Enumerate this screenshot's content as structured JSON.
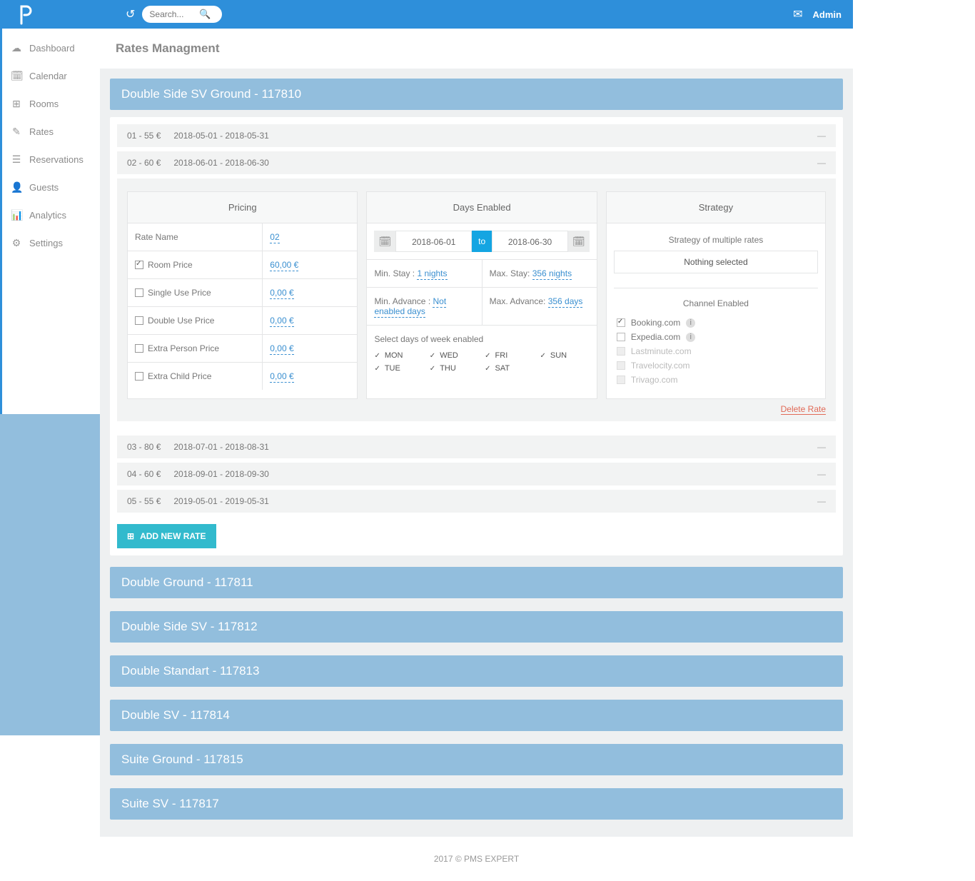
{
  "header": {
    "search_placeholder": "Search...",
    "user": "Admin"
  },
  "sidebar": {
    "items": [
      {
        "label": "Dashboard",
        "icon": "☁"
      },
      {
        "label": "Calendar",
        "icon": "🗓"
      },
      {
        "label": "Rooms",
        "icon": "⊞"
      },
      {
        "label": "Rates",
        "icon": "✎"
      },
      {
        "label": "Reservations",
        "icon": "☰"
      },
      {
        "label": "Guests",
        "icon": "👤"
      },
      {
        "label": "Analytics",
        "icon": "📊"
      },
      {
        "label": "Settings",
        "icon": "⚙"
      }
    ]
  },
  "page": {
    "title": "Rates Managment"
  },
  "room_types": [
    {
      "label": "Double Side SV Ground - 117810",
      "expanded": true
    },
    {
      "label": "Double Ground - 117811"
    },
    {
      "label": "Double Side SV - 117812"
    },
    {
      "label": "Double Standart - 117813"
    },
    {
      "label": "Double SV - 117814"
    },
    {
      "label": "Suite Ground - 117815"
    },
    {
      "label": "Suite SV - 117817"
    }
  ],
  "rates": [
    {
      "id": "01 - 55 €",
      "range": "2018-05-01 - 2018-05-31"
    },
    {
      "id": "02 - 60 €",
      "range": "2018-06-01 - 2018-06-30"
    },
    {
      "id": "03 - 80 €",
      "range": "2018-07-01 - 2018-08-31"
    },
    {
      "id": "04 - 60 €",
      "range": "2018-09-01 - 2018-09-30"
    },
    {
      "id": "05 - 55 €",
      "range": "2019-05-01 - 2019-05-31"
    }
  ],
  "pricing": {
    "header": "Pricing",
    "rows": [
      {
        "label": "Rate Name",
        "value": "02",
        "has_cb": false
      },
      {
        "label": "Room Price",
        "value": "60,00 €",
        "checked": true
      },
      {
        "label": "Single Use Price",
        "value": "0,00 €",
        "checked": false
      },
      {
        "label": "Double Use Price",
        "value": "0,00 €",
        "checked": false
      },
      {
        "label": "Extra Person Price",
        "value": "0,00 €",
        "checked": false
      },
      {
        "label": "Extra Child Price",
        "value": "0,00 €",
        "checked": false
      }
    ]
  },
  "days": {
    "header": "Days Enabled",
    "from": "2018-06-01",
    "to_label": "to",
    "to": "2018-06-30",
    "min_stay_label": "Min. Stay : ",
    "min_stay_val": "1 nights",
    "max_stay_label": "Max. Stay: ",
    "max_stay_val": "356 nights",
    "min_adv_label": "Min. Advance : ",
    "min_adv_val": "Not enabled days",
    "max_adv_label": "Max. Advance: ",
    "max_adv_val": "356 days",
    "week_label": "Select days of week enabled",
    "weekdays": [
      "MON",
      "WED",
      "FRI",
      "SUN",
      "TUE",
      "THU",
      "SAT"
    ]
  },
  "strategy": {
    "header": "Strategy",
    "label": "Strategy of multiple rates",
    "selected": "Nothing selected",
    "channel_label": "Channel Enabled",
    "channels": [
      {
        "name": "Booking.com",
        "on": true,
        "info": true,
        "enabled": true
      },
      {
        "name": "Expedia.com",
        "on": false,
        "info": true,
        "enabled": true
      },
      {
        "name": "Lastminute.com",
        "on": false,
        "info": false,
        "enabled": false
      },
      {
        "name": "Travelocity.com",
        "on": false,
        "info": false,
        "enabled": false
      },
      {
        "name": "Trivago.com",
        "on": false,
        "info": false,
        "enabled": false
      }
    ]
  },
  "actions": {
    "delete": "Delete Rate",
    "add": "ADD NEW RATE"
  },
  "footer": "2017 © PMS EXPERT"
}
